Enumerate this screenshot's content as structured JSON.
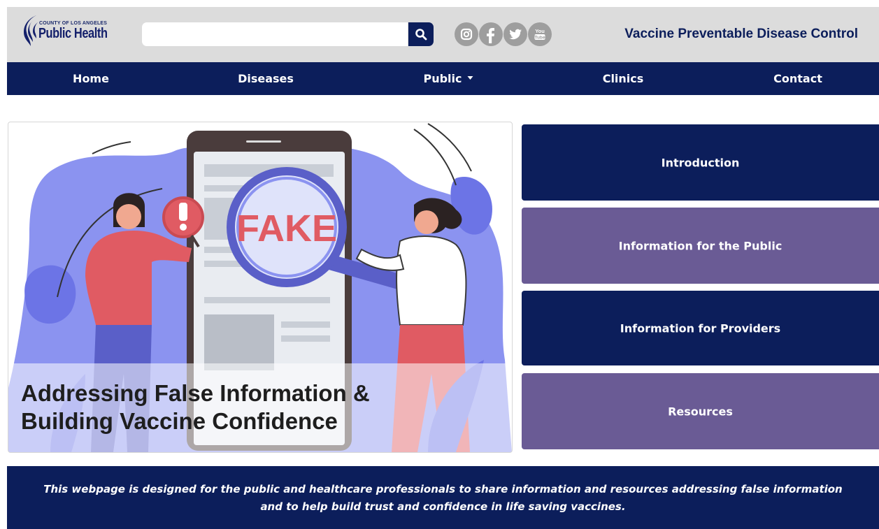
{
  "header": {
    "logo_small": "COUNTY OF LOS ANGELES",
    "logo_big": "Public Health",
    "search": {
      "placeholder": "",
      "value": ""
    },
    "social": [
      {
        "icon": "instagram-icon"
      },
      {
        "icon": "facebook-icon"
      },
      {
        "icon": "twitter-icon"
      },
      {
        "icon": "youtube-icon",
        "label_top": "You",
        "label_bottom": "Tube"
      }
    ],
    "site_title": "Vaccine Preventable Disease Control"
  },
  "nav": {
    "items": [
      "Home",
      "Diseases",
      "Public",
      "Clinics",
      "Contact"
    ]
  },
  "hero": {
    "image_word": "FAKE",
    "title_line1": "Addressing False Information &",
    "title_line2": "Building Vaccine Confidence"
  },
  "side_buttons": [
    "Introduction",
    "Information for the Public",
    "Information for Providers",
    "Resources"
  ],
  "banner": {
    "line1": "This webpage is designed for the public and healthcare professionals to share information and resources addressing false information",
    "line2": "and to help build trust and confidence in life saving vaccines."
  },
  "colors": {
    "navy": "#0c1e5b",
    "purple": "#6a5b95",
    "header_gray": "#dcdcdc",
    "social_gray": "#9e9e9e"
  }
}
